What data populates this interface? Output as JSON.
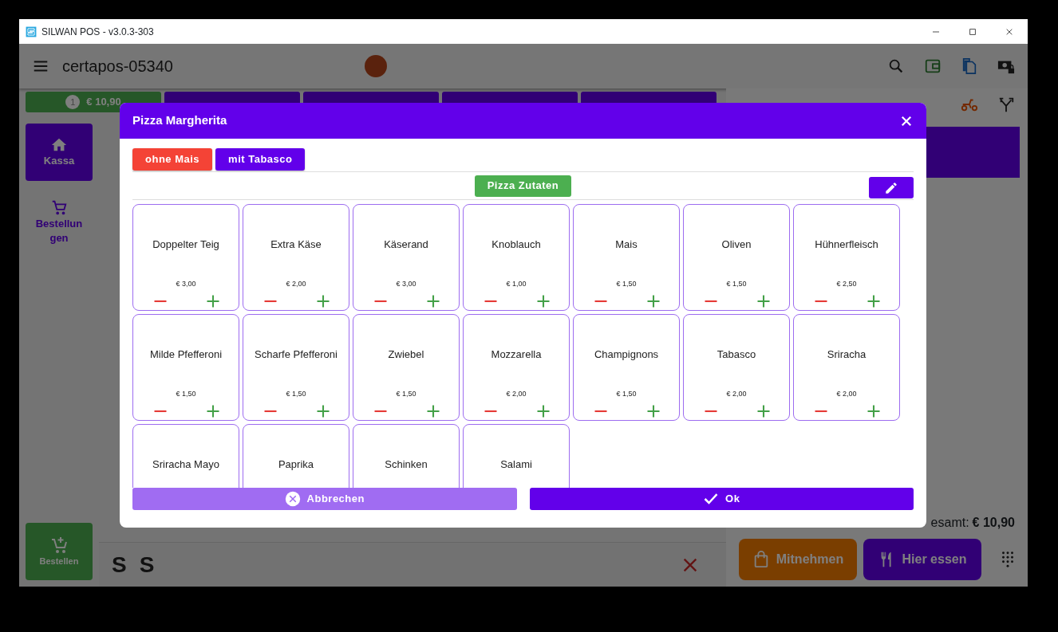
{
  "window": {
    "title": "SILWAN POS - v3.0.3-303"
  },
  "header": {
    "title": "certapos-05340"
  },
  "order_tabs": [
    {
      "number": "1",
      "amount": "€ 10,90",
      "selected": true
    },
    {
      "selected": false
    },
    {
      "selected": false
    },
    {
      "selected": false
    },
    {
      "selected": false
    }
  ],
  "sidebar": {
    "items": [
      {
        "label": "Kassa",
        "selected": true,
        "kind": "home"
      },
      {
        "label": "Bestellungen",
        "selected": false,
        "kind": "cart"
      }
    ],
    "order_button": "Bestellen"
  },
  "bottom_bar": {
    "letters": [
      "S",
      "S"
    ]
  },
  "order_panel": {
    "total_label": "esamt:",
    "total": "€ 10,90",
    "buttons": [
      {
        "label": "Mitnehmen",
        "kind": "takeaway"
      },
      {
        "label": "Hier essen",
        "kind": "dinein"
      }
    ]
  },
  "dialog": {
    "title": "Pizza Margherita",
    "modifiers": [
      {
        "label": "ohne Mais",
        "kind": "remove"
      },
      {
        "label": "mit Tabasco",
        "kind": "add"
      }
    ],
    "category": "Pizza Zutaten",
    "ingredients": [
      {
        "name": "Doppelter Teig",
        "price": "€ 3,00"
      },
      {
        "name": "Extra Käse",
        "price": "€ 2,00"
      },
      {
        "name": "Käserand",
        "price": "€ 3,00"
      },
      {
        "name": "Knoblauch",
        "price": "€ 1,00"
      },
      {
        "name": "Mais",
        "price": "€ 1,50"
      },
      {
        "name": "Oliven",
        "price": "€ 1,50"
      },
      {
        "name": "Hühnerfleisch",
        "price": "€ 2,50"
      },
      {
        "name": "Milde Pfefferoni",
        "price": "€ 1,50"
      },
      {
        "name": "Scharfe Pfefferoni",
        "price": "€ 1,50"
      },
      {
        "name": "Zwiebel",
        "price": "€ 1,50"
      },
      {
        "name": "Mozzarella",
        "price": "€ 2,00"
      },
      {
        "name": "Champignons",
        "price": "€ 1,50"
      },
      {
        "name": "Tabasco",
        "price": "€ 2,00"
      },
      {
        "name": "Sriracha",
        "price": "€ 2,00"
      },
      {
        "name": "Sriracha Mayo"
      },
      {
        "name": "Paprika"
      },
      {
        "name": "Schinken"
      },
      {
        "name": "Salami"
      }
    ],
    "cancel": "Abbrechen",
    "ok": "Ok"
  }
}
